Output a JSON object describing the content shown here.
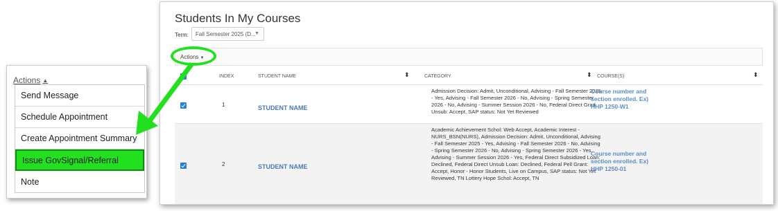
{
  "menu": {
    "trigger_label": "Actions",
    "items": [
      {
        "label": "Send Message"
      },
      {
        "label": "Schedule Appointment"
      },
      {
        "label": "Create Appointment Summary"
      },
      {
        "label": "Issue GovSignal/Referral"
      },
      {
        "label": "Note"
      }
    ]
  },
  "page": {
    "title": "Students In My Courses",
    "term_label": "Term:",
    "term_value": "Fall Semester 2025 (D..."
  },
  "actions_button": "Actions",
  "table": {
    "headers": {
      "index": "INDEX",
      "student_name": "STUDENT NAME",
      "category": "CATEGORY",
      "courses": "COURSE(S)"
    },
    "rows": [
      {
        "index": "1",
        "name": "STUDENT NAME",
        "category": "Admission Decision: Admit, Unconditional, Advising - Fall Semester 2025 - Yes, Advising - Fall Semester 2026 - No, Advising - Spring Semester 2026 - No, Advising - Summer Session 2026 - No, Federal Direct Grad Unsub: Accept, SAP status: Not Yet Reviewed",
        "course": "Course number and section enrolled. Ex) HHP 1250-W1"
      },
      {
        "index": "2",
        "name": "STUDENT NAME",
        "category": "Academic Achievement Schol: Web Accept, Academic Interest - NURS_BSN(NURS), Admission Decision: Admit, Unconditional, Advising - Fall Semester 2025 - Yes, Advising - Fall Semester 2026 - No, Advising - Spring Semester 2026 - No, Advising - Spring Semester 2026 - Yes, Advising - Summer Session 2026 - Yes, Federal Direct Subsidized Loan: Declined, Federal Direct Unsub Loan: Declined, Federal Pell Grant: Accept, Honor - Honor Students, Live on Campus, SAP status: Not Yet Reviewed, TN Lottery Hope Schol: Accept, TN",
        "course": "Course number and section enrolled. Ex) HHP 1250-01"
      }
    ]
  },
  "colors": {
    "highlight": "#22e01f",
    "link": "#4a7ab8",
    "checkbox": "#2a7fd4"
  }
}
